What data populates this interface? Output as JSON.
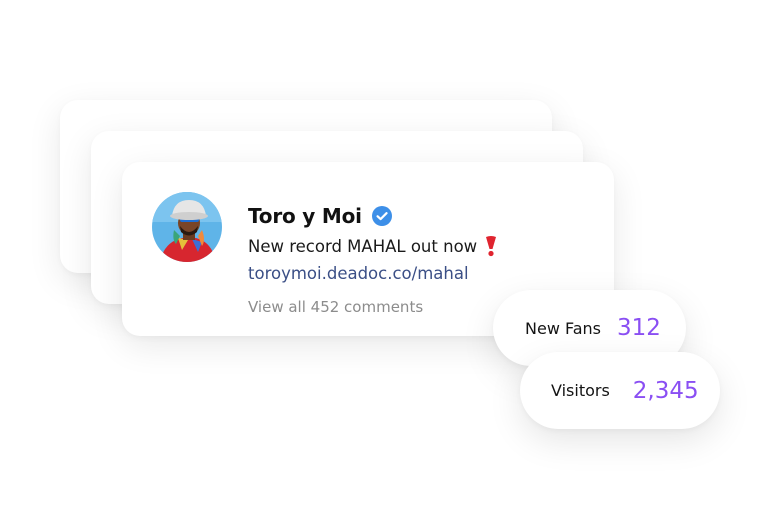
{
  "post": {
    "author": "Toro y Moi",
    "verified": true,
    "caption": "New record MAHAL out now",
    "link": "toroymoi.deadoc.co/mahal",
    "comments_link": "View all 452 comments"
  },
  "stats": {
    "new_fans": {
      "label": "New Fans",
      "value": "312"
    },
    "visitors": {
      "label": "Visitors",
      "value": "2,345"
    }
  },
  "icons": {
    "verified": "verified-badge-icon",
    "exclamation": "red-exclamation-icon"
  },
  "colors": {
    "accent": "#8a4ff3",
    "link": "#3b4f86",
    "verified": "#3d8fe8",
    "exclamation": "#e0242f",
    "muted": "#8c8c8c"
  }
}
